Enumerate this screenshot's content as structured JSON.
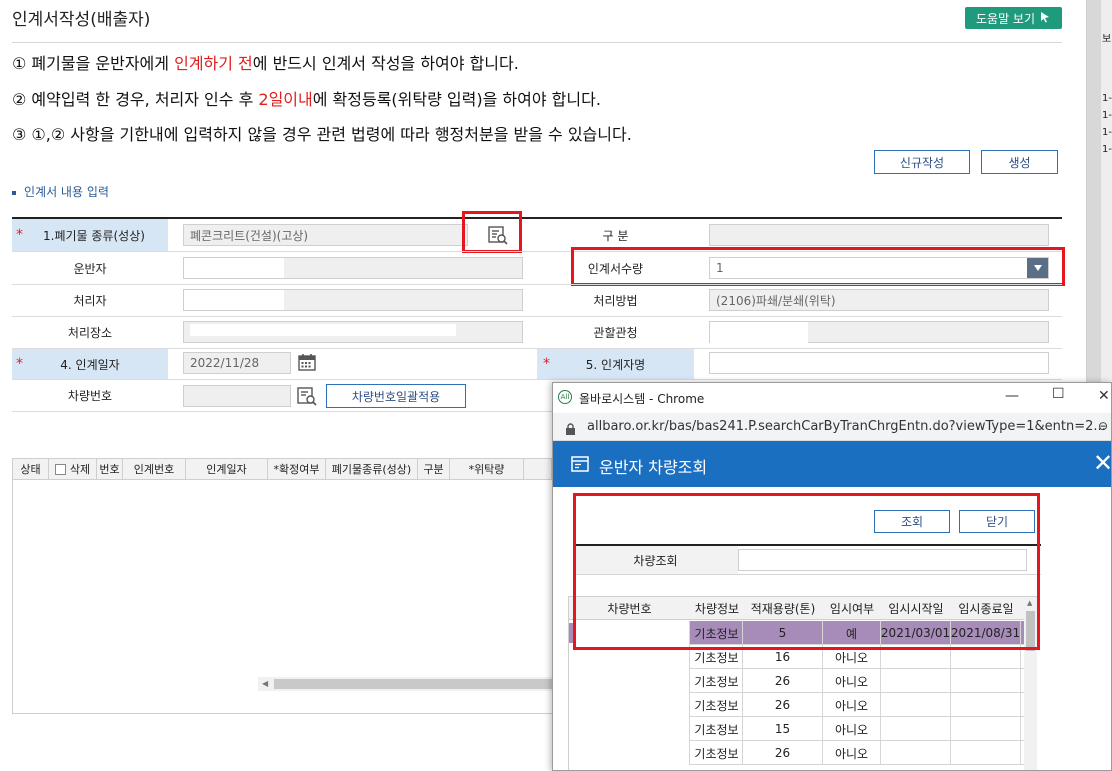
{
  "header": {
    "title": "인계서작성(배출자)",
    "help_button": "도움말 보기"
  },
  "notices": [
    {
      "prefix": "① 폐기물을 운반자에게 ",
      "highlight": "인계하기 전",
      "suffix": "에 반드시 인계서 작성을 하여야 합니다."
    },
    {
      "prefix": "② 예약입력 한 경우, 처리자 인수 후 ",
      "highlight": "2일이내",
      "suffix": "에 확정등록(위탁량 입력)을 하여야 합니다."
    },
    {
      "prefix": "③ ①,② 사항을 기한내에 입력하지 않을 경우 관련 법령에 따라 행정처분을 받을 수 있습니다.",
      "highlight": "",
      "suffix": ""
    }
  ],
  "actions": {
    "new_button": "신규작성",
    "create_button": "생성"
  },
  "section_label": "인계서 내용 입력",
  "form": {
    "required_mark": "*",
    "waste_type_label": "1.폐기물 종류(성상)",
    "waste_type_value": "폐콘크리트(건설)(고상)",
    "category_label": "구 분",
    "carrier_label": "운반자",
    "quantity_label": "인계서수량",
    "quantity_value": "1",
    "processor_label": "처리자",
    "method_label": "처리방법",
    "method_value": "(2106)파쇄/분쇄(위탁)",
    "site_label": "처리장소",
    "office_label": "관할관청",
    "date_label": "4. 인계일자",
    "date_value": "2022/11/28",
    "handover_name_label": "5. 인계자명",
    "vehicle_label": "차량번호",
    "vehicle_bulk_button": "차량번호일괄적용"
  },
  "grid": {
    "columns": [
      "상태",
      "삭제",
      "번호",
      "인계번호",
      "인계일자",
      "*확정여부",
      "폐기물종류(성상)",
      "구분",
      "*위탁량"
    ]
  },
  "right_strip": {
    "items": [
      "보",
      "1-",
      "1-",
      "1-",
      "1-"
    ]
  },
  "popup": {
    "window_title": "올바로시스템 - Chrome",
    "url": "allbaro.or.kr/bas/bas241.P.searchCarByTranChrgEntn.do?viewType=1&entn=2...",
    "header_title": "운반자 차량조회",
    "search_button": "조회",
    "close_button": "닫기",
    "search_label": "차량조회",
    "columns": [
      "차량번호",
      "차량정보",
      "적재용량(톤)",
      "임시여부",
      "임시시작일",
      "임시종료일"
    ],
    "rows": [
      {
        "info": "기초정보",
        "capacity": "5",
        "temp": "예",
        "start": "2021/03/01",
        "end": "2021/08/31"
      },
      {
        "info": "기초정보",
        "capacity": "16",
        "temp": "아니오",
        "start": "",
        "end": ""
      },
      {
        "info": "기초정보",
        "capacity": "26",
        "temp": "아니오",
        "start": "",
        "end": ""
      },
      {
        "info": "기초정보",
        "capacity": "26",
        "temp": "아니오",
        "start": "",
        "end": ""
      },
      {
        "info": "기초정보",
        "capacity": "15",
        "temp": "아니오",
        "start": "",
        "end": ""
      },
      {
        "info": "기초정보",
        "capacity": "26",
        "temp": "아니오",
        "start": "",
        "end": ""
      }
    ],
    "colors": {
      "header": "#1b6fc1",
      "selected_row": "#a78bb8"
    }
  }
}
